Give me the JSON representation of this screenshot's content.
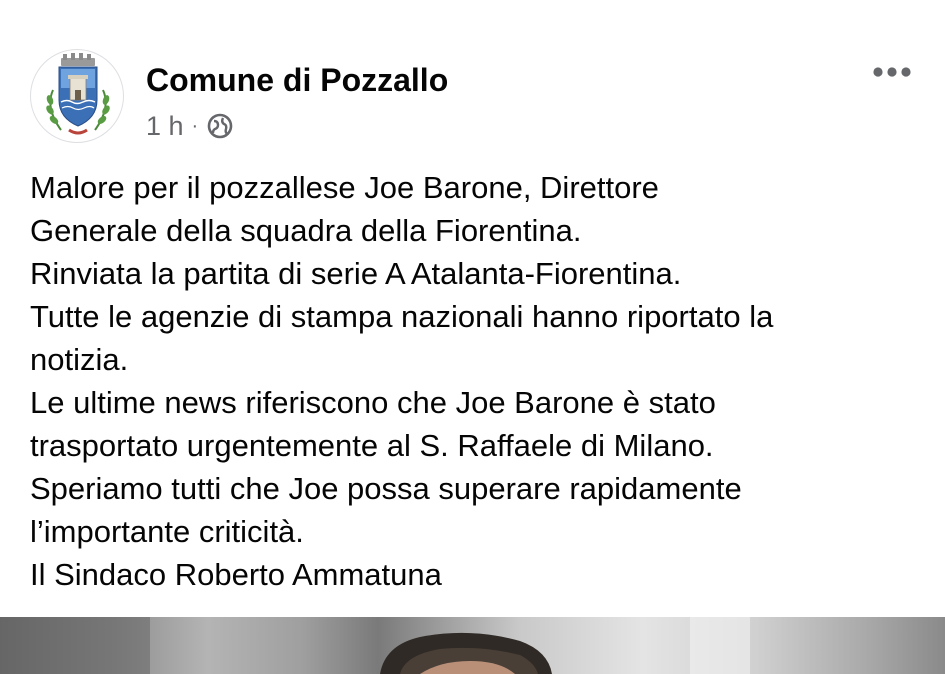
{
  "post": {
    "page_name": "Comune di Pozzallo",
    "timestamp": "1 h",
    "separator": "·",
    "audience_icon": "globe-icon",
    "more_icon": "more-options-icon",
    "text_lines": [
      "Malore per il pozzallese  Joe Barone, Direttore",
      "Generale della squadra della Fiorentina.",
      "Rinviata la partita di serie A Atalanta-Fiorentina.",
      "Tutte le agenzie di stampa nazionali hanno riportato la",
      "notizia.",
      "Le ultime news riferiscono che Joe Barone è stato",
      "trasportato urgentemente al S. Raffaele di Milano.",
      "Speriamo tutti che Joe possa superare rapidamente",
      "l’importante criticità.",
      "Il Sindaco Roberto Ammatuna"
    ]
  },
  "colors": {
    "text_primary": "#050505",
    "text_secondary": "#65676b",
    "background": "#ffffff",
    "crest_blue": "#3b6fb6",
    "crest_green": "#4c8a3a"
  }
}
